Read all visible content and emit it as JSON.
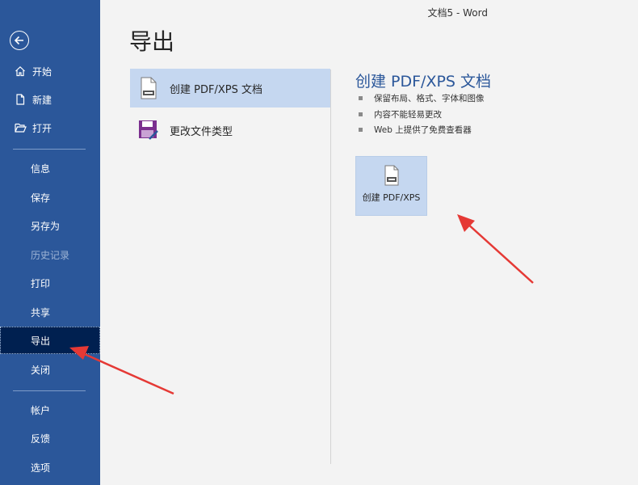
{
  "window": {
    "title": "文档5  -  Word"
  },
  "sidebar": {
    "back_label": "",
    "top_items": [
      {
        "label": "开始",
        "icon": "home-icon"
      },
      {
        "label": "新建",
        "icon": "new-document-icon"
      },
      {
        "label": "打开",
        "icon": "open-folder-icon"
      }
    ],
    "items": [
      {
        "label": "信息"
      },
      {
        "label": "保存"
      },
      {
        "label": "另存为"
      },
      {
        "label": "历史记录",
        "disabled": true
      },
      {
        "label": "打印"
      },
      {
        "label": "共享"
      },
      {
        "label": "导出",
        "active": true
      },
      {
        "label": "关闭"
      }
    ],
    "bottom_items": [
      {
        "label": "帐户"
      },
      {
        "label": "反馈"
      },
      {
        "label": "选项"
      }
    ]
  },
  "page": {
    "title": "导出"
  },
  "export_options": [
    {
      "label": "创建 PDF/XPS 文档",
      "icon": "pdf-document-icon",
      "selected": true
    },
    {
      "label": "更改文件类型",
      "icon": "save-disk-icon",
      "selected": false
    }
  ],
  "detail": {
    "title": "创建 PDF/XPS 文档",
    "bullets": [
      "保留布局、格式、字体和图像",
      "内容不能轻易更改",
      "Web 上提供了免费查看器"
    ],
    "button_label": "创建 PDF/XPS"
  },
  "colors": {
    "sidebar_bg": "#2b579a",
    "sidebar_active": "#002050",
    "accent_title": "#2b579a",
    "selected_bg": "#c5d7f0",
    "annotation_arrow": "#e53935"
  }
}
